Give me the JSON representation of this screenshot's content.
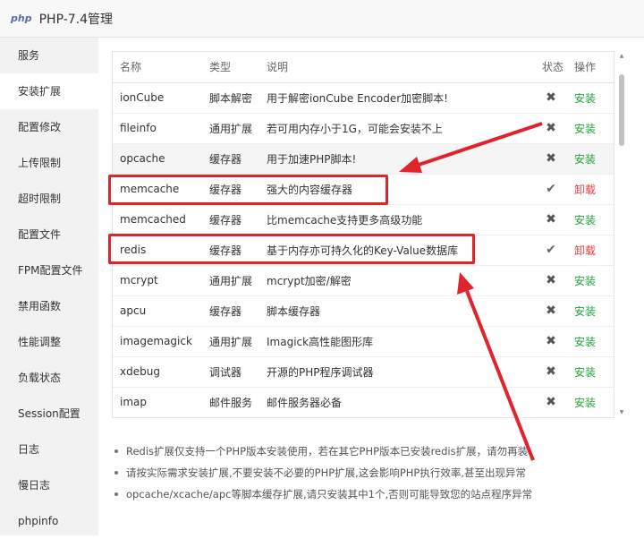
{
  "window": {
    "logo": "php",
    "title": "PHP-7.4管理"
  },
  "sidebar": {
    "items": [
      {
        "label": "服务"
      },
      {
        "label": "安装扩展"
      },
      {
        "label": "配置修改"
      },
      {
        "label": "上传限制"
      },
      {
        "label": "超时限制"
      },
      {
        "label": "配置文件"
      },
      {
        "label": "FPM配置文件"
      },
      {
        "label": "禁用函数"
      },
      {
        "label": "性能调整"
      },
      {
        "label": "负载状态"
      },
      {
        "label": "Session配置"
      },
      {
        "label": "日志"
      },
      {
        "label": "慢日志"
      },
      {
        "label": "phpinfo"
      }
    ],
    "active_index": 1
  },
  "table": {
    "headers": {
      "name": "名称",
      "type": "类型",
      "desc": "说明",
      "status": "状态",
      "action": "操作"
    },
    "rows": [
      {
        "name": "ionCube",
        "type": "脚本解密",
        "desc": "用于解密ionCube Encoder加密脚本!",
        "status": "✖",
        "action": "安装"
      },
      {
        "name": "fileinfo",
        "type": "通用扩展",
        "desc": "若可用内存小于1G，可能会安装不上",
        "status": "✖",
        "action": "安装"
      },
      {
        "name": "opcache",
        "type": "缓存器",
        "desc": "用于加速PHP脚本!",
        "status": "✖",
        "action": "安装"
      },
      {
        "name": "memcache",
        "type": "缓存器",
        "desc": "强大的内容缓存器",
        "status": "✔",
        "action": "卸载"
      },
      {
        "name": "memcached",
        "type": "缓存器",
        "desc": "比memcache支持更多高级功能",
        "status": "✖",
        "action": "安装"
      },
      {
        "name": "redis",
        "type": "缓存器",
        "desc": "基于内存亦可持久化的Key-Value数据库",
        "status": "✔",
        "action": "卸载"
      },
      {
        "name": "mcrypt",
        "type": "通用扩展",
        "desc": "mcrypt加密/解密",
        "status": "✖",
        "action": "安装"
      },
      {
        "name": "apcu",
        "type": "缓存器",
        "desc": "脚本缓存器",
        "status": "✖",
        "action": "安装"
      },
      {
        "name": "imagemagick",
        "type": "通用扩展",
        "desc": "Imagick高性能图形库",
        "status": "✖",
        "action": "安装"
      },
      {
        "name": "xdebug",
        "type": "调试器",
        "desc": "开源的PHP程序调试器",
        "status": "✖",
        "action": "安装"
      },
      {
        "name": "imap",
        "type": "邮件服务",
        "desc": "邮件服务器必备",
        "status": "✖",
        "action": "安装"
      }
    ]
  },
  "notes": [
    "Redis扩展仅支持一个PHP版本安装使用，若在其它PHP版本已安装redis扩展，请勿再装",
    "请按实际需求安装扩展,不要安装不必要的PHP扩展,这会影响PHP执行效率,甚至出现异常",
    "opcache/xcache/apc等脚本缓存扩展,请只安装其中1个,否则可能导致您的站点程序异常"
  ],
  "colors": {
    "install": "#20a53a",
    "uninstall": "#e23d3d",
    "annotation": "#e0242b"
  },
  "icons": {
    "installed": "check-icon",
    "not_installed": "x-icon"
  }
}
